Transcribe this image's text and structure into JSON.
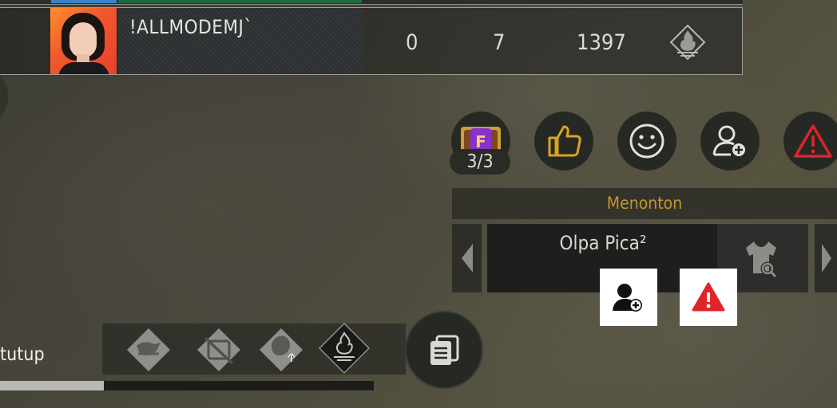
{
  "player": {
    "name": "!ALLMODEMJ`",
    "stats": [
      "0",
      "7",
      "1397"
    ],
    "rank_icon": "flame-rank-icon"
  },
  "actions": {
    "gift_badge": "3/3",
    "icons": [
      "gift-box-icon",
      "thumbs-up-icon",
      "smiley-icon",
      "add-friend-icon",
      "report-icon"
    ]
  },
  "spectate": {
    "label": "Menonton",
    "target_name": "Olpa Pica²"
  },
  "bottom": {
    "close_label": "tutup",
    "progress": 0.277
  },
  "colors": {
    "accent_gold": "#c2952d",
    "report_red": "#e0242c",
    "thumb_gold": "#d9a520"
  }
}
